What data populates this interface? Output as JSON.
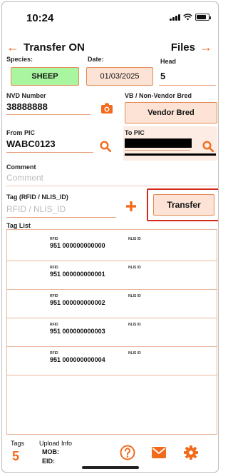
{
  "status": {
    "time": "10:24"
  },
  "nav": {
    "title": "Transfer ON",
    "files": "Files"
  },
  "species": {
    "label": "Species:",
    "value": "SHEEP"
  },
  "date": {
    "label": "Date:",
    "value": "01/03/2025"
  },
  "head": {
    "label": "Head",
    "value": "5"
  },
  "nvd": {
    "label": "NVD Number",
    "value": "38888888"
  },
  "vb": {
    "label": "VB / Non-Vendor Bred",
    "value": "Vendor Bred"
  },
  "from_pic": {
    "label": "From PIC",
    "value": "WABC0123"
  },
  "to_pic": {
    "label": "To PIC"
  },
  "comment": {
    "label": "Comment",
    "placeholder": "Comment"
  },
  "tag": {
    "label": "Tag (RFID / NLIS_ID)",
    "placeholder": "RFID / NLIS_ID"
  },
  "transfer_button": "Transfer",
  "tag_list": {
    "label": "Tag List",
    "rfid_label": "RFID",
    "nlis_label": "NLIS ID",
    "rows": [
      {
        "rfid": "951 000000000000"
      },
      {
        "rfid": "951 000000000001"
      },
      {
        "rfid": "951 000000000002"
      },
      {
        "rfid": "951 000000000003"
      },
      {
        "rfid": "951 000000000004"
      }
    ]
  },
  "footer": {
    "tags_label": "Tags",
    "tags_count": "5",
    "upload_label": "Upload Info",
    "mob_label": "MOB:",
    "eid_label": "EID:"
  },
  "colors": {
    "accent": "#f26b1d",
    "species_bg": "#a9f5a0",
    "pill_bg": "#fde3d5"
  }
}
